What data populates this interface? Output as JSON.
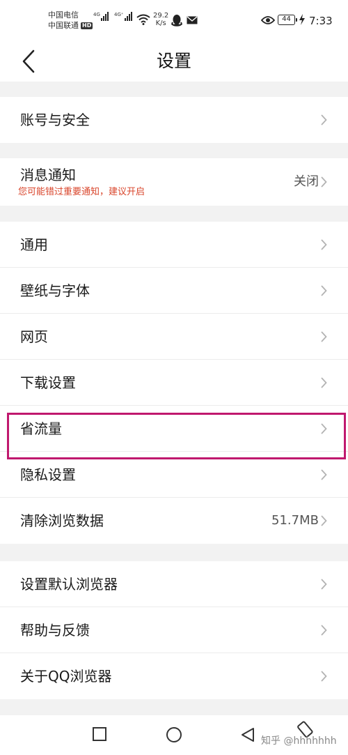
{
  "status_bar": {
    "carrier_1": "中国电信",
    "carrier_2": "中国联通",
    "hd_badge": "HD",
    "signal_1_label": "4G",
    "signal_2_label": "4G⁺",
    "net_speed_value": "29.2",
    "net_speed_unit": "K/s",
    "battery": "44",
    "time": "7:33"
  },
  "header": {
    "title": "设置"
  },
  "groups": {
    "account": {
      "items": [
        {
          "label": "账号与安全"
        }
      ]
    },
    "notifications": {
      "label": "消息通知",
      "subtitle": "您可能错过重要通知，建议开启",
      "value": "关闭"
    },
    "general": {
      "items": [
        {
          "label": "通用"
        },
        {
          "label": "壁纸与字体"
        },
        {
          "label": "网页"
        },
        {
          "label": "下载设置"
        },
        {
          "label": "省流量"
        },
        {
          "label": "隐私设置"
        },
        {
          "label": "清除浏览数据",
          "value": "51.7MB"
        }
      ]
    },
    "more": {
      "items": [
        {
          "label": "设置默认浏览器"
        },
        {
          "label": "帮助与反馈"
        },
        {
          "label": "关于QQ浏览器"
        }
      ]
    }
  },
  "highlight_color": "#c0186e",
  "warning_color": "#d9452b",
  "icons": {
    "back": "chevron-left-icon",
    "row": "chevron-right-icon",
    "nav_recent": "square-icon",
    "nav_home": "circle-icon",
    "nav_back": "triangle-back-icon",
    "rotate": "rotate-icon"
  },
  "watermark": "知乎 @hhhhhhh"
}
